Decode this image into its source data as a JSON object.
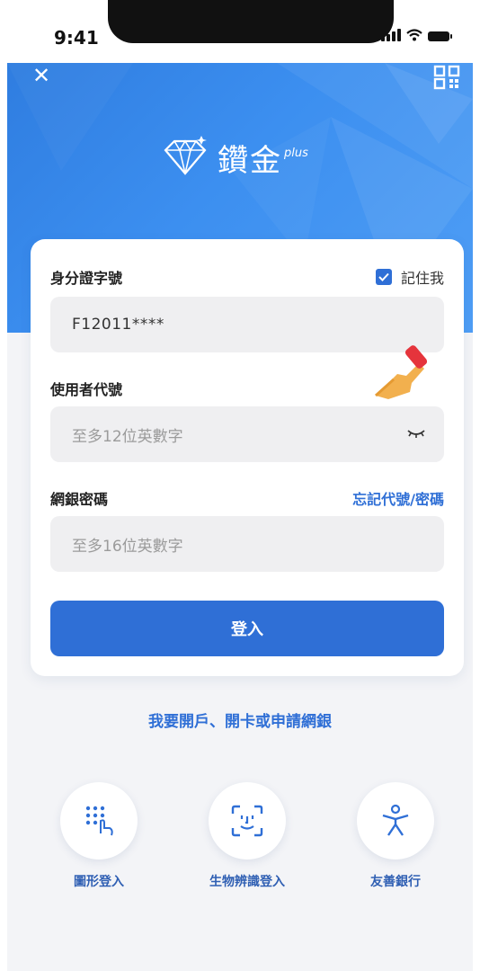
{
  "status_bar": {
    "time": "9:41"
  },
  "header": {
    "logo_text": "鑽金",
    "logo_plus": "plus"
  },
  "form": {
    "id_label": "身分證字號",
    "remember_label": "記住我",
    "remember_checked": true,
    "id_value": "F12011****",
    "user_label": "使用者代號",
    "user_placeholder": "至多12位英數字",
    "password_label": "網銀密碼",
    "forgot_label": "忘記代號/密碼",
    "password_placeholder": "至多16位英數字",
    "login_label": "登入"
  },
  "links": {
    "open_account": "我要開戶、開卡或申請網銀"
  },
  "quick_options": [
    {
      "label": "圖形登入",
      "icon": "pattern-dots-icon"
    },
    {
      "label": "生物辨識登入",
      "icon": "face-id-icon"
    },
    {
      "label": "友善銀行",
      "icon": "accessibility-icon"
    }
  ],
  "colors": {
    "primary": "#2f6fd6",
    "hero": "#3c8ff0",
    "field_bg": "#efeff1"
  }
}
